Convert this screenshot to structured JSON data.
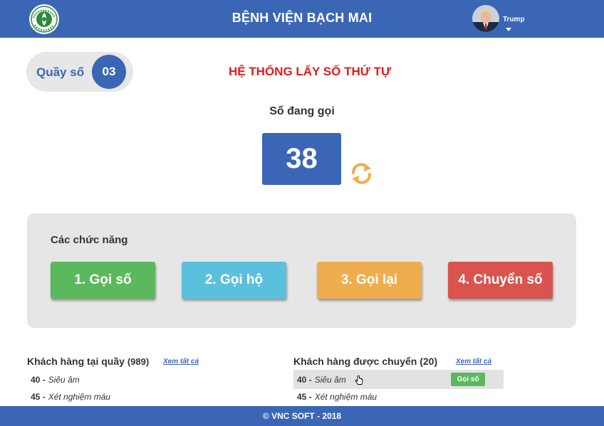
{
  "header": {
    "title": "BỆNH VIỆN BẠCH MAI",
    "logo_icon": "hospital-logo-icon",
    "user": {
      "name": "Trump",
      "avatar_icon": "user-avatar"
    }
  },
  "counter": {
    "label": "Quầy số",
    "number": "03"
  },
  "system_title": "HỆ THỐNG LẤY SỐ THỨ TỰ",
  "calling": {
    "label": "Số đang gọi",
    "number": "38",
    "refresh_icon": "refresh-icon"
  },
  "functions": {
    "label": "Các chức năng",
    "buttons": [
      {
        "label": "1. Gọi số",
        "color": "#5cb85c"
      },
      {
        "label": "2. Gọi hộ",
        "color": "#5bc0de"
      },
      {
        "label": "3. Gọi lại",
        "color": "#f0ad4e"
      },
      {
        "label": "4. Chuyển số",
        "color": "#d9534f"
      }
    ]
  },
  "queue_list": {
    "title": "Khách hàng tại quầy",
    "count": "(989)",
    "see_all": "Xem tất cả",
    "rows": [
      {
        "num": "40 -",
        "service": "Siêu âm"
      },
      {
        "num": "45 -",
        "service": "Xét nghiệm máu"
      }
    ]
  },
  "transferred_list": {
    "title": "Khách hàng được chuyển",
    "count": "(20)",
    "see_all": "Xem tất cả",
    "rows": [
      {
        "num": "40 -",
        "service": "Siêu âm",
        "action": "Gọi số"
      },
      {
        "num": "45 -",
        "service": "Xét nghiệm máu"
      }
    ]
  },
  "footer": {
    "text": "© VNC SOFT - 2018"
  },
  "colors": {
    "primary": "#3b66b5",
    "title_red": "#e41b1b",
    "panel_bg": "#e6e6e6"
  }
}
